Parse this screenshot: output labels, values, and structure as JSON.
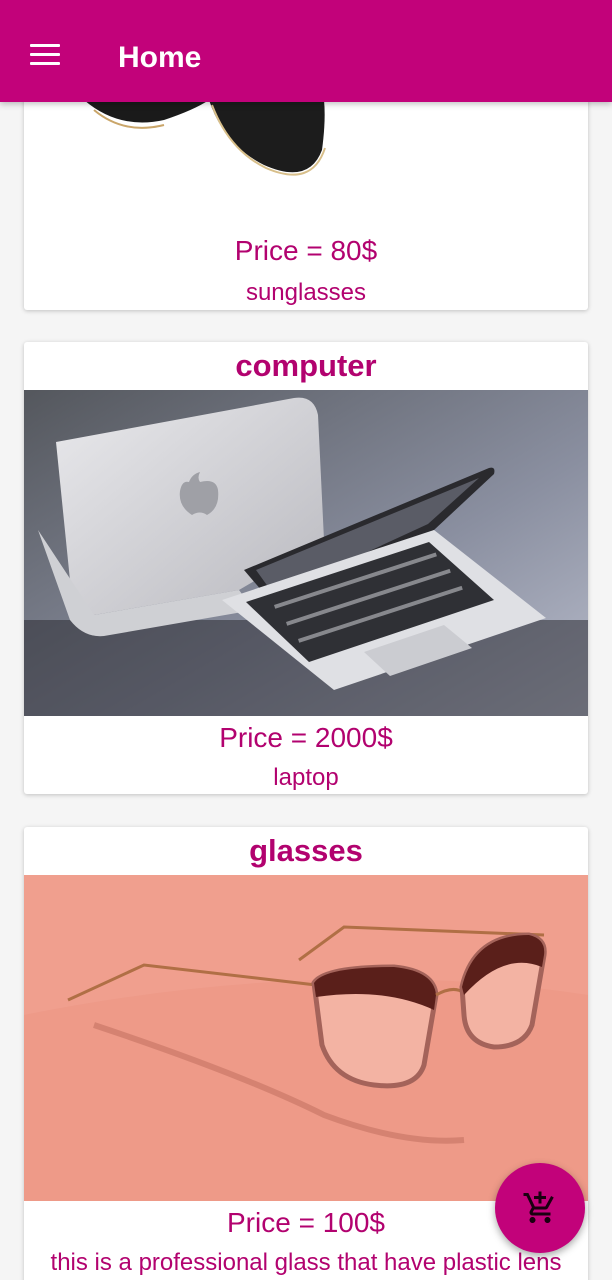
{
  "appbar": {
    "title": "Home",
    "menu_icon": "hamburger-menu-icon",
    "color": "#c2027a"
  },
  "products": [
    {
      "name": "",
      "price_text": "Price = 80$",
      "description": "sunglasses",
      "image": "sunglasses-photo"
    },
    {
      "name": "computer",
      "price_text": "Price = 2000$",
      "description": "laptop",
      "image": "laptop-photo"
    },
    {
      "name": "glasses",
      "price_text": "Price = 100$",
      "description": "this is a professional glass that have plastic lens",
      "image": "eyeglasses-photo"
    }
  ],
  "fab": {
    "icon": "add-shopping-cart-icon"
  },
  "colors": {
    "accent_text": "#b2026f",
    "primary": "#c2027a",
    "background": "#f5f5f5"
  }
}
